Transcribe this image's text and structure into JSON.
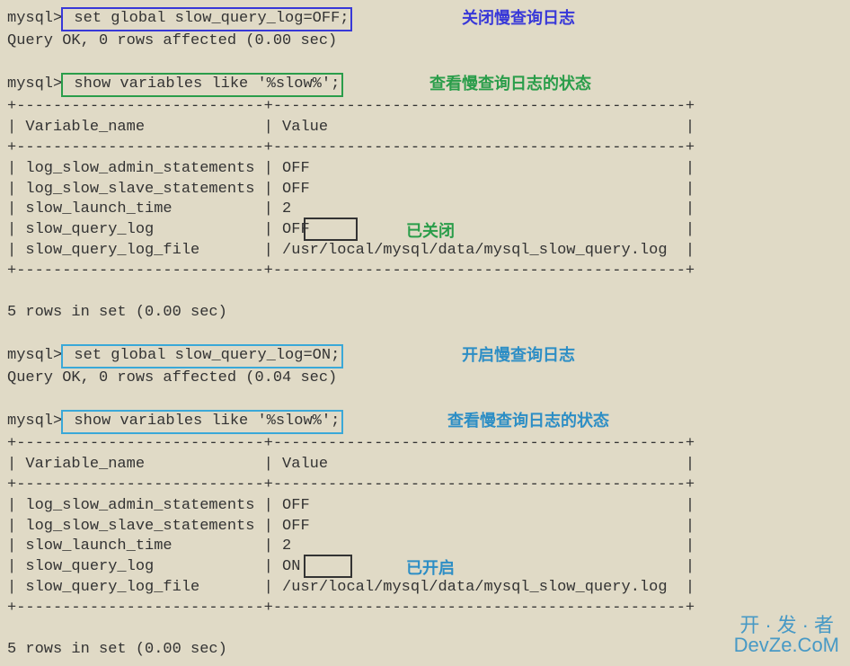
{
  "prompt": "mysql>",
  "cmd1": " set global slow_query_log=OFF;",
  "result1": "Query OK, 0 rows affected (0.00 sec)",
  "ann1": "关闭慢查询日志",
  "cmd2": " show variables like '%slow%';",
  "ann2": "查看慢查询日志的状态",
  "divider": "+---------------------------+---------------------------------------------+",
  "header": "| Variable_name             | Value                                       |",
  "row1": "| log_slow_admin_statements | OFF                                         |",
  "row2": "| log_slow_slave_statements | OFF                                         |",
  "row3": "| slow_launch_time          | 2                                           |",
  "row4_off": "| slow_query_log            | OFF                                         |",
  "row4_on": "| slow_query_log            | ON                                          |",
  "row5": "| slow_query_log_file       | /usr/local/mysql/data/mysql_slow_query.log  |",
  "footer1": "5 rows in set (0.00 sec)",
  "ann3": "已关闭",
  "cmd3": " set global slow_query_log=ON;",
  "result3": "Query OK, 0 rows affected (0.04 sec)",
  "ann4": "开启慢查询日志",
  "ann5": "查看慢查询日志的状态",
  "ann6": "已开启",
  "watermark1": "开·发·者",
  "watermark2": "DevZe.CoM"
}
